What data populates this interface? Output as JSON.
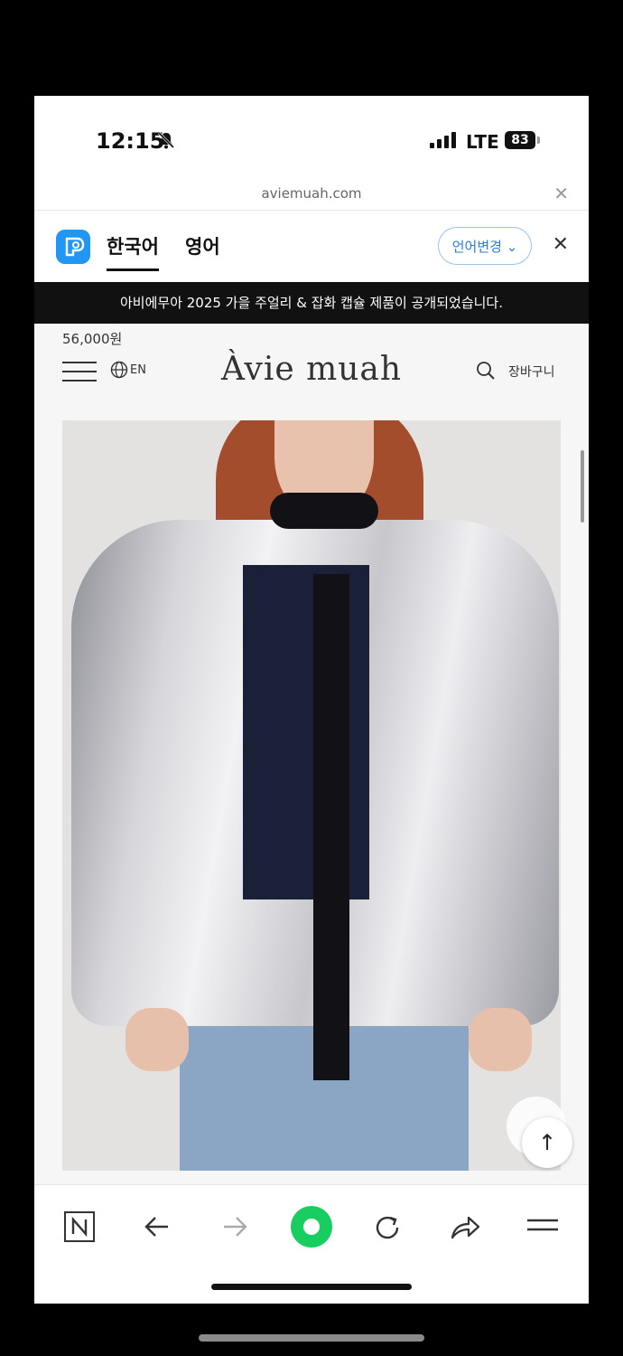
{
  "status_bar": {
    "time": "12:15",
    "network": "LTE",
    "battery": "83"
  },
  "browser": {
    "url": "aviemuah.com"
  },
  "translate_bar": {
    "source_lang": "한국어",
    "target_lang": "영어",
    "change_label": "언어변경"
  },
  "notice": "아비에무아 2025 가을 주얼리 & 잡화 캡슐 제품이 공개되었습니다.",
  "site": {
    "price": "56,000원",
    "lang": "EN",
    "logo": "Àvie muah",
    "cart": "장바구니"
  },
  "colors": {
    "accent": "#2a7ed6",
    "naver_green": "#19ce60",
    "notice_bg": "#111111"
  },
  "toolbar": {
    "icons": [
      "naver-icon",
      "back-icon",
      "forward-icon",
      "green-dot-icon",
      "refresh-icon",
      "share-icon",
      "menu-icon"
    ]
  }
}
